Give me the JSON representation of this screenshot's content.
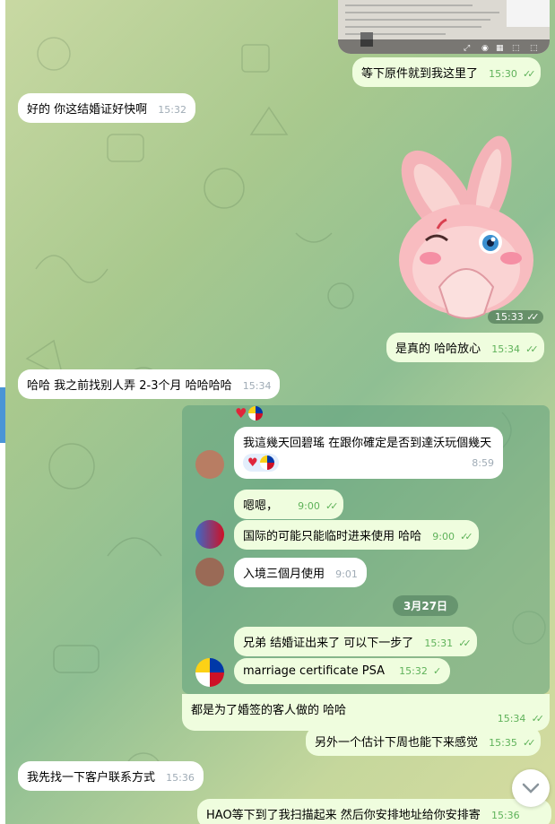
{
  "messages": {
    "m1": {
      "text": "等下原件就到我这里了",
      "time": "15:30"
    },
    "m2": {
      "text": "好的 你这结婚证好快啊",
      "time": "15:32"
    },
    "sticker": {
      "time": "15:33"
    },
    "m3": {
      "text": "是真的 哈哈放心",
      "time": "15:34"
    },
    "m4": {
      "text": "哈哈 我之前找别人弄 2-3个月 哈哈哈哈",
      "time": "15:34"
    },
    "f1": {
      "text": "我這幾天回碧瑤 在跟你確定是否到達沃玩個幾天",
      "time": "8:59"
    },
    "f2": {
      "text": "嗯嗯，",
      "time": "9:00"
    },
    "f3": {
      "text": "国际的可能只能临时进来使用 哈哈",
      "time": "9:00"
    },
    "f4": {
      "text": "入境三個月使用",
      "time": "9:01"
    },
    "date_separator": "3月27日",
    "f5": {
      "text": "兄弟 结婚证出来了 可以下一步了",
      "time": "15:31"
    },
    "f6": {
      "text": "marriage certificate PSA",
      "time": "15:32"
    },
    "m5": {
      "text": "都是为了婚签的客人做的 哈哈",
      "time": "15:34"
    },
    "m6": {
      "text": "另外一个估计下周也能下来感觉",
      "time": "15:35"
    },
    "m7": {
      "text": "我先找一下客户联系方式",
      "time": "15:36"
    },
    "m8": {
      "text": "HAO等下到了我扫描起来 然后你安排地址给你安排寄",
      "time": "15:36"
    }
  },
  "icons": {
    "heart": "♥",
    "check": "✓✓",
    "chevron": "chevron-down-icon"
  },
  "colors": {
    "outgoing_bubble": "#effdde",
    "incoming_bubble": "#ffffff",
    "check_green": "#5fb25a",
    "accent_blue": "#4a95d6"
  }
}
